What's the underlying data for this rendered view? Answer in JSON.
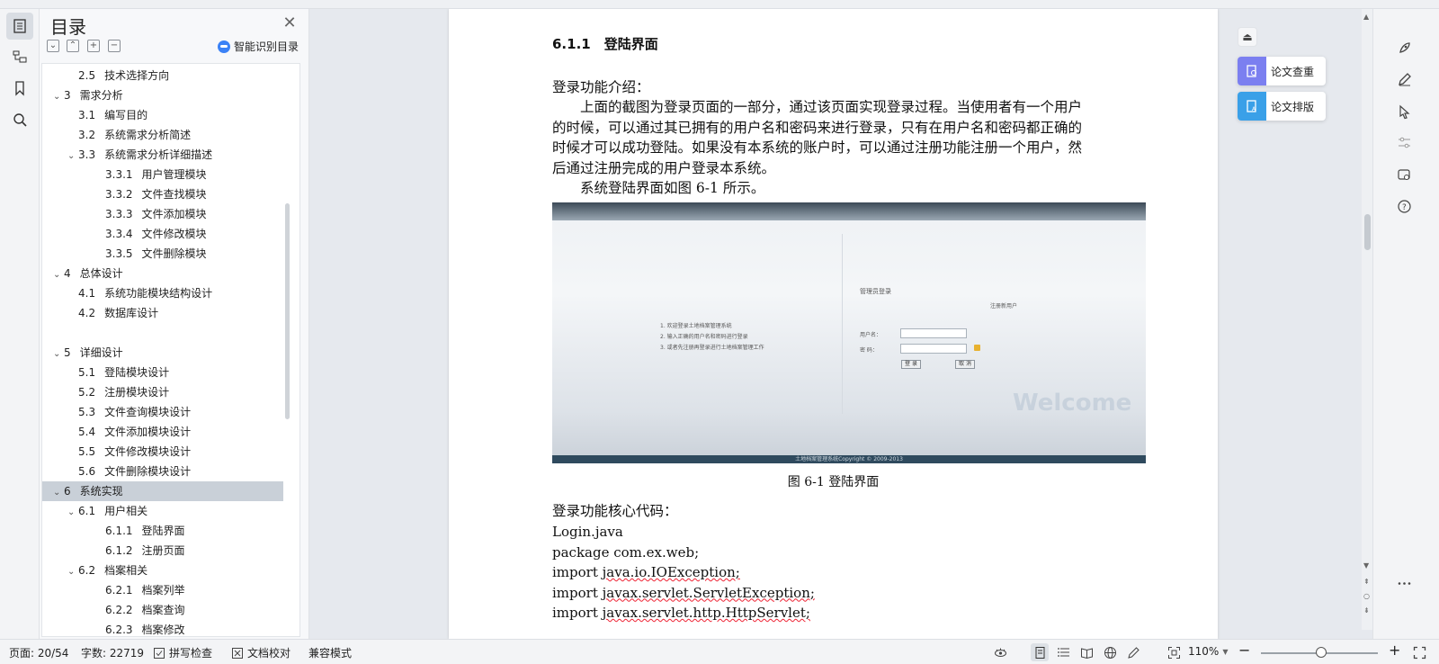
{
  "outline": {
    "title": "目录",
    "smart_label": "智能识别目录",
    "items": [
      {
        "caret": "",
        "num": "2.5",
        "label": "技术选择方向",
        "level": 2
      },
      {
        "caret": "v",
        "num": "3",
        "label": "需求分析",
        "level": 1
      },
      {
        "caret": "",
        "num": "3.1",
        "label": "编写目的",
        "level": 2
      },
      {
        "caret": "",
        "num": "3.2",
        "label": "系统需求分析简述",
        "level": 2
      },
      {
        "caret": "v",
        "num": "3.3",
        "label": "系统需求分析详细描述",
        "level": 2
      },
      {
        "caret": "",
        "num": "3.3.1",
        "label": "用户管理模块",
        "level": 3
      },
      {
        "caret": "",
        "num": "3.3.2",
        "label": "文件查找模块",
        "level": 3
      },
      {
        "caret": "",
        "num": "3.3.3",
        "label": "文件添加模块",
        "level": 3
      },
      {
        "caret": "",
        "num": "3.3.4",
        "label": "文件修改模块",
        "level": 3
      },
      {
        "caret": "",
        "num": "3.3.5",
        "label": "文件删除模块",
        "level": 3
      },
      {
        "caret": "v",
        "num": "4",
        "label": "总体设计",
        "level": 1
      },
      {
        "caret": "",
        "num": "4.1",
        "label": "系统功能模块结构设计",
        "level": 2
      },
      {
        "caret": "",
        "num": "4.2",
        "label": "数据库设计",
        "level": 2
      },
      {
        "caret": "",
        "num": "",
        "label": "",
        "level": 2
      },
      {
        "caret": "v",
        "num": "5",
        "label": "详细设计",
        "level": 1
      },
      {
        "caret": "",
        "num": "5.1",
        "label": "登陆模块设计",
        "level": 2
      },
      {
        "caret": "",
        "num": "5.2",
        "label": "注册模块设计",
        "level": 2
      },
      {
        "caret": "",
        "num": "5.3",
        "label": "文件查询模块设计",
        "level": 2
      },
      {
        "caret": "",
        "num": "5.4",
        "label": "文件添加模块设计",
        "level": 2
      },
      {
        "caret": "",
        "num": "5.5",
        "label": "文件修改模块设计",
        "level": 2
      },
      {
        "caret": "",
        "num": "5.6",
        "label": "文件删除模块设计",
        "level": 2
      },
      {
        "caret": "v",
        "num": "6",
        "label": "系统实现",
        "level": 1,
        "selected": true
      },
      {
        "caret": "v",
        "num": "6.1",
        "label": "用户相关",
        "level": 2
      },
      {
        "caret": "",
        "num": "6.1.1",
        "label": "登陆界面",
        "level": 3
      },
      {
        "caret": "",
        "num": "6.1.2",
        "label": "注册页面",
        "level": 3
      },
      {
        "caret": "v",
        "num": "6.2",
        "label": "档案相关",
        "level": 2
      },
      {
        "caret": "",
        "num": "6.2.1",
        "label": "档案列举",
        "level": 3
      },
      {
        "caret": "",
        "num": "6.2.2",
        "label": "档案查询",
        "level": 3
      },
      {
        "caret": "",
        "num": "6.2.3",
        "label": "档案修改",
        "level": 3
      }
    ]
  },
  "document": {
    "heading": "6.1.1　登陆界面",
    "intro_label": "登录功能介绍：",
    "para1_lines": [
      "　　上面的截图为登录页面的一部分，通过该页面实现登录过程。当使用者有一个用户",
      "的时候，可以通过其已拥有的用户名和密码来进行登录，只有在用户名和密码都正确的",
      "时候才可以成功登陆。如果没有本系统的账户时，可以通过注册功能注册一个用户，然",
      "后通过注册完成的用户登录本系统。"
    ],
    "para2": "　　系统登陆界面如图 6-1 所示。",
    "figure_caption": "图 6-1 登陆界面",
    "code_label": "登录功能核心代码：",
    "code_lines": [
      {
        "text": "Login.java",
        "squiggle": ""
      },
      {
        "text": "package com.ex.web;",
        "squiggle": ""
      },
      {
        "text": "import ",
        "squiggle": "java.io.IOException;"
      },
      {
        "text": "import ",
        "squiggle": "javax.servlet.ServletException;"
      },
      {
        "text": "import ",
        "squiggle": "javax.servlet.http.HttpServlet;"
      }
    ],
    "screenshot": {
      "tips": [
        "1. 欢迎登录土地档案管理系统",
        "2. 输入正确的用户名和密码进行登录",
        "3. 或者先注册再登录进行土地档案管理工作"
      ],
      "admin_login": "管理员登录",
      "register_link": "注册新用户",
      "username_label": "用户名：",
      "password_label": "密 码：",
      "login_btn": "登 录",
      "cancel_btn": "取 消",
      "welcome": "Welcome",
      "footer": "土地档案管理系统Copyright © 2009-2013"
    }
  },
  "plugins": {
    "check": "论文查重",
    "format": "论文排版",
    "check_color": "#7b7ff0",
    "format_color": "#3aa0e8"
  },
  "status": {
    "page": "页面: 20/54",
    "words": "字数: 22719",
    "spell": "拼写检查",
    "proof": "文档校对",
    "compat": "兼容模式",
    "zoom": "110%"
  }
}
